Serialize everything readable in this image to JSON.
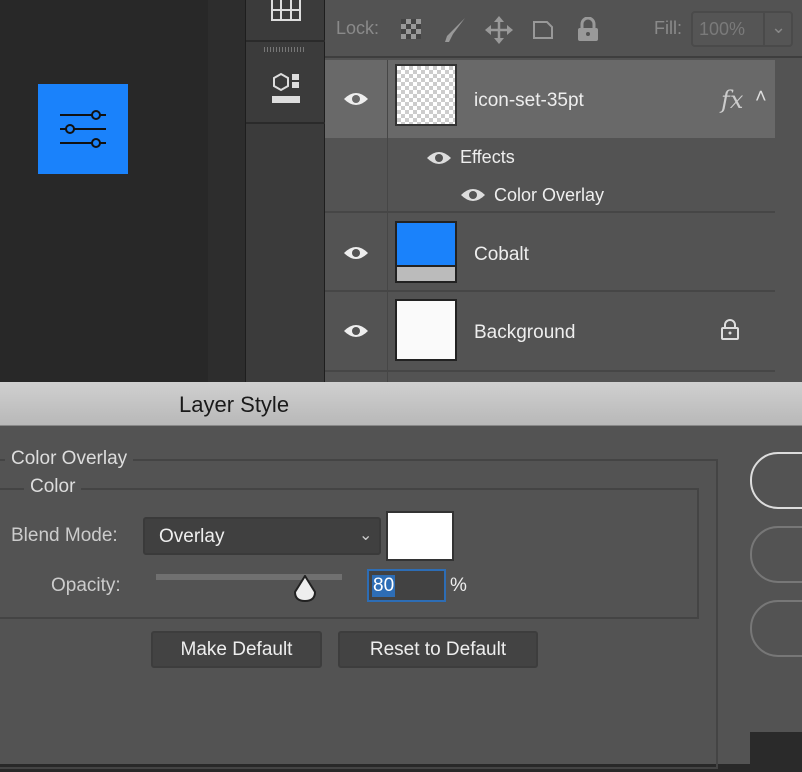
{
  "colors": {
    "accent": "#1a82fb",
    "panel": "#535353",
    "selection": "#2d6db5"
  },
  "lock": {
    "label": "Lock:",
    "icons": [
      "transparent-pixels-lock-icon",
      "brush-lock-icon",
      "move-lock-icon",
      "artboard-lock-icon",
      "padlock-icon"
    ]
  },
  "fill": {
    "label": "Fill:",
    "value": "100%"
  },
  "layers": [
    {
      "name": "icon-set-35pt",
      "fx": "fx",
      "selected": true,
      "effects_label": "Effects",
      "effects": [
        "Color Overlay"
      ]
    },
    {
      "name": "Cobalt"
    },
    {
      "name": "Background",
      "locked": true
    }
  ],
  "dialog": {
    "title": "Layer Style",
    "section": "Color Overlay",
    "group": "Color",
    "blend_label": "Blend Mode:",
    "blend_value": "Overlay",
    "swatch_color": "#ffffff",
    "opacity_label": "Opacity:",
    "opacity_value": "80",
    "opacity_unit": "%",
    "opacity_percent": 80,
    "make_default": "Make Default",
    "reset_default": "Reset to Default"
  }
}
